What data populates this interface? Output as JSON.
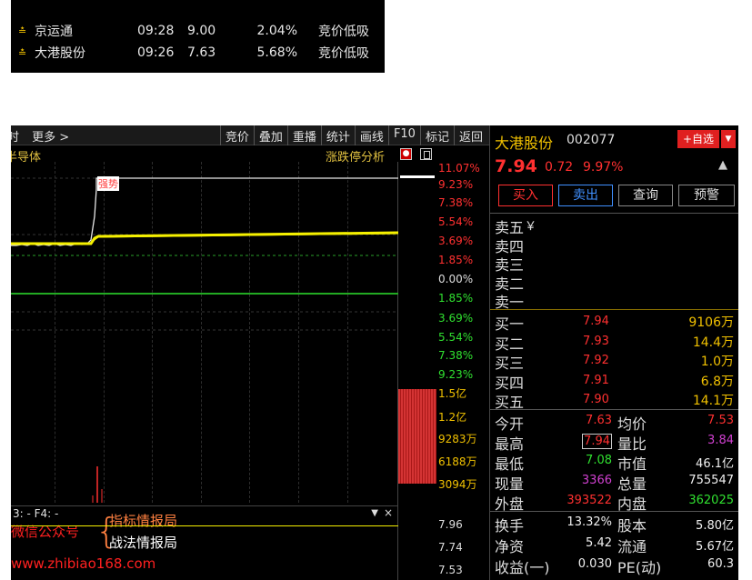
{
  "snippet": {
    "rows": [
      {
        "arrow": "≛",
        "name": "京运通",
        "time": "09:28",
        "price": "9.00",
        "pct": "2.04%",
        "type": "竞价低吸"
      },
      {
        "arrow": "≛",
        "name": "大港股份",
        "time": "09:26",
        "price": "7.63",
        "pct": "5.68%",
        "type": "竞价低吸"
      }
    ]
  },
  "toolbar": {
    "left_prefix": "时",
    "more": "更多 >",
    "buttons": [
      "竞价",
      "叠加",
      "重播",
      "统计",
      "画线",
      "F10",
      "标记",
      "返回"
    ]
  },
  "chart": {
    "sector": "半导体",
    "analysis": "涨跌停分析",
    "strong_tag": "强势",
    "y_labels": [
      {
        "text": "11.07%",
        "color": "#ff3030"
      },
      {
        "text": "9.23%",
        "color": "#ff3030"
      },
      {
        "text": "7.38%",
        "color": "#ff3030"
      },
      {
        "text": "5.54%",
        "color": "#ff3030"
      },
      {
        "text": "3.69%",
        "color": "#ff3030"
      },
      {
        "text": "1.85%",
        "color": "#ff3030"
      },
      {
        "text": "0.00%",
        "color": "#dddddd"
      },
      {
        "text": "1.85%",
        "color": "#30e030"
      },
      {
        "text": "3.69%",
        "color": "#30e030"
      },
      {
        "text": "5.54%",
        "color": "#30e030"
      },
      {
        "text": "7.38%",
        "color": "#30e030"
      },
      {
        "text": "9.23%",
        "color": "#30e030"
      }
    ],
    "vol_labels": [
      "1.5亿",
      "1.2亿",
      "9283万",
      "6188万",
      "3094万"
    ],
    "bottom_labels": [
      "7.96",
      "7.74",
      "7.53"
    ]
  },
  "indicator": {
    "head": "3: -  F4: -",
    "dropdown": "▼",
    "close": "×"
  },
  "brand": {
    "wechat": "微信公众号",
    "brace": "{",
    "line1": "指标情报局",
    "line2": "战法情报局",
    "url": "www.zhibiao168.com"
  },
  "quote": {
    "name": "大港股份",
    "code": "002077",
    "add_label": "+自选",
    "add_arrow": "▼",
    "price": "7.94",
    "change": "0.72",
    "change_pct": "9.97%",
    "bell_icon": "bell-icon",
    "actions": {
      "buy": "买入",
      "sell": "卖出",
      "query": "查询",
      "alert": "预警"
    },
    "asks": [
      {
        "label": "卖五",
        "extra": "￥"
      },
      {
        "label": "卖四",
        "extra": ""
      },
      {
        "label": "卖三",
        "extra": ""
      },
      {
        "label": "卖二",
        "extra": ""
      },
      {
        "label": "卖一",
        "extra": ""
      }
    ],
    "bids": [
      {
        "label": "买一",
        "price": "7.94",
        "vol": "9106万"
      },
      {
        "label": "买二",
        "price": "7.93",
        "vol": "14.4万"
      },
      {
        "label": "买三",
        "price": "7.92",
        "vol": "1.0万"
      },
      {
        "label": "买四",
        "price": "7.91",
        "vol": "6.8万"
      },
      {
        "label": "买五",
        "price": "7.90",
        "vol": "14.1万"
      }
    ],
    "stats": [
      {
        "l1": "今开",
        "v1": "7.63",
        "c1": "red",
        "l2": "均价",
        "v2": "7.53",
        "c2": "red"
      },
      {
        "l1": "最高",
        "v1": "7.94",
        "c1": "red",
        "boxed": true,
        "l2": "量比",
        "v2": "3.84",
        "c2": "purple"
      },
      {
        "l1": "最低",
        "v1": "7.08",
        "c1": "green",
        "l2": "市值",
        "v2": "46.1亿",
        "c2": "white"
      },
      {
        "l1": "现量",
        "v1": "3366",
        "c1": "purple",
        "l2": "总量",
        "v2": "755547",
        "c2": "white"
      },
      {
        "l1": "外盘",
        "v1": "393522",
        "c1": "red",
        "l2": "内盘",
        "v2": "362025",
        "c2": "green"
      }
    ],
    "stats2": [
      {
        "l1": "换手",
        "v1": "13.32%",
        "c1": "white",
        "l2": "股本",
        "v2": "5.80亿",
        "c2": "white"
      },
      {
        "l1": "净资",
        "v1": "5.42",
        "c1": "white",
        "l2": "流通",
        "v2": "5.67亿",
        "c2": "white"
      },
      {
        "l1": "收益(一)",
        "v1": "0.030",
        "c1": "white",
        "l2": "PE(动)",
        "v2": "60.3",
        "c2": "white"
      }
    ]
  },
  "colors": {
    "up": "#ff3030",
    "down": "#30e030",
    "accent": "#f0c000",
    "background": "#000000"
  }
}
